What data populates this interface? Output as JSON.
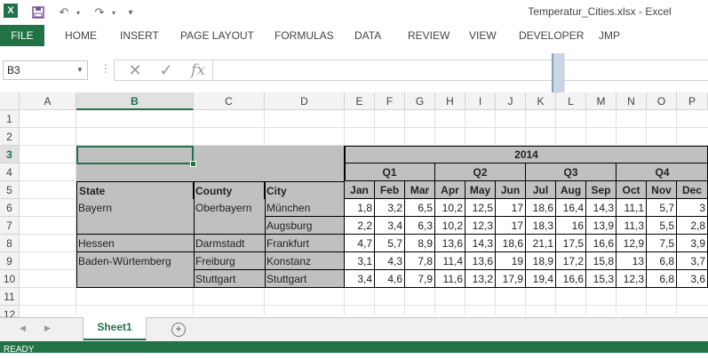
{
  "window": {
    "title": "Temperatur_Cities.xlsx - Excel",
    "logo": "X",
    "undo_glyph": "↶",
    "redo_glyph": "↷",
    "customize_glyph": "▾"
  },
  "ribbon": {
    "file": "FILE",
    "tabs": [
      "HOME",
      "INSERT",
      "PAGE LAYOUT",
      "FORMULAS",
      "DATA",
      "REVIEW",
      "VIEW",
      "DEVELOPER",
      "JMP"
    ]
  },
  "formula_bar": {
    "name_box": "B3",
    "cancel_glyph": "✕",
    "enter_glyph": "✓",
    "fx": "fx",
    "value": ""
  },
  "columns": [
    "A",
    "B",
    "C",
    "D",
    "E",
    "F",
    "G",
    "H",
    "I",
    "J",
    "K",
    "L",
    "M",
    "N",
    "O",
    "P"
  ],
  "rows": [
    "1",
    "2",
    "3",
    "4",
    "5",
    "6",
    "7",
    "8",
    "9",
    "10",
    "11",
    "12"
  ],
  "selected_cell": {
    "col": "B",
    "row": "3"
  },
  "table": {
    "year": "2014",
    "quarters": [
      "Q1",
      "Q2",
      "Q3",
      "Q4"
    ],
    "headers": {
      "state": "State",
      "county": "County",
      "city": "City"
    },
    "months": [
      "Jan",
      "Feb",
      "Mar",
      "Apr",
      "May",
      "Jun",
      "Jul",
      "Aug",
      "Sep",
      "Oct",
      "Nov",
      "Dec"
    ],
    "rows": [
      {
        "state": "Bayern",
        "county": "Oberbayern",
        "city": "München",
        "values": [
          "1,8",
          "3,2",
          "6,5",
          "10,2",
          "12,5",
          "17",
          "18,6",
          "16,4",
          "14,3",
          "11,1",
          "5,7",
          "3"
        ]
      },
      {
        "state": "",
        "county": "",
        "city": "Augsburg",
        "values": [
          "2,2",
          "3,4",
          "6,3",
          "10,2",
          "12,3",
          "17",
          "18,3",
          "16",
          "13,9",
          "11,3",
          "5,5",
          "2,8"
        ]
      },
      {
        "state": "Hessen",
        "county": "Darmstadt",
        "city": "Frankfurt",
        "values": [
          "4,7",
          "5,7",
          "8,9",
          "13,6",
          "14,3",
          "18,6",
          "21,1",
          "17,5",
          "16,6",
          "12,9",
          "7,5",
          "3,9"
        ]
      },
      {
        "state": "Baden-Würtemberg",
        "county": "Freiburg",
        "city": "Konstanz",
        "values": [
          "3,1",
          "4,3",
          "7,8",
          "11,4",
          "13,6",
          "19",
          "18,9",
          "17,2",
          "15,8",
          "13",
          "6,8",
          "3,7"
        ]
      },
      {
        "state": "",
        "county": "Stuttgart",
        "city": "Stuttgart",
        "values": [
          "3,4",
          "4,6",
          "7,9",
          "11,6",
          "13,2",
          "17,9",
          "19,4",
          "16,6",
          "15,3",
          "12,3",
          "6,8",
          "3,6"
        ]
      }
    ]
  },
  "sheet_tabs": {
    "active": "Sheet1",
    "add_glyph": "+",
    "nav_left": "◀",
    "nav_right": "▶"
  },
  "status": {
    "text": "READY"
  }
}
